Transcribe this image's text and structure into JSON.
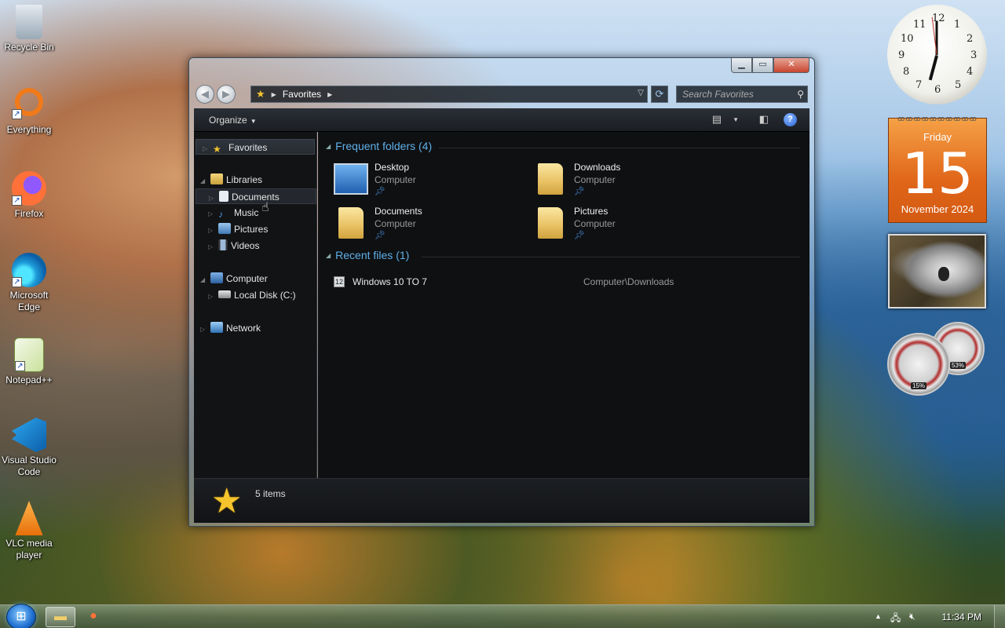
{
  "desktop": {
    "icons": [
      {
        "label": "Recycle Bin",
        "icon": "recycle-bin-icon",
        "color": "#bfcbd6"
      },
      {
        "label": "Everything",
        "icon": "everything-icon",
        "color": "#f07a1a"
      },
      {
        "label": "Firefox",
        "icon": "firefox-icon",
        "color": "#ff7139"
      },
      {
        "label": "Microsoft Edge",
        "icon": "edge-icon",
        "color": "#1d9bd8"
      },
      {
        "label": "Notepad++",
        "icon": "notepadpp-icon",
        "color": "#8ec63f"
      },
      {
        "label": "Visual Studio Code",
        "icon": "vscode-icon",
        "color": "#1f8ad2"
      },
      {
        "label": "VLC media player",
        "icon": "vlc-icon",
        "color": "#f08a0c"
      }
    ]
  },
  "window": {
    "buttons": {
      "minimize": "▁",
      "maximize": "▭",
      "close": "✕"
    },
    "address": {
      "location": "Favorites",
      "star": "★"
    },
    "search_placeholder": "Search Favorites",
    "toolbar": {
      "organize_label": "Organize"
    },
    "nav_pane": {
      "favorites": "Favorites",
      "libraries": "Libraries",
      "documents": "Documents",
      "music": "Music",
      "pictures": "Pictures",
      "videos": "Videos",
      "computer": "Computer",
      "local_disk": "Local Disk (C:)",
      "network": "Network"
    },
    "content": {
      "frequent_header": "Frequent folders (4)",
      "frequent": [
        {
          "name": "Desktop",
          "location": "Computer"
        },
        {
          "name": "Downloads",
          "location": "Computer"
        },
        {
          "name": "Documents",
          "location": "Computer"
        },
        {
          "name": "Pictures",
          "location": "Computer"
        }
      ],
      "recent_header": "Recent files (1)",
      "recent": [
        {
          "name": "Windows 10 TO 7",
          "path": "Computer\\Downloads"
        }
      ]
    },
    "details": {
      "count": "5 items"
    }
  },
  "gadgets": {
    "calendar": {
      "day": "Friday",
      "date": "15",
      "month": "November 2024"
    },
    "cpu": {
      "label": "15%"
    },
    "memory": {
      "label": "53%"
    }
  },
  "taskbar": {
    "time": "11:34 PM"
  },
  "colors": {
    "accent": "#5fb0e8",
    "calendar": "#e0661a"
  }
}
